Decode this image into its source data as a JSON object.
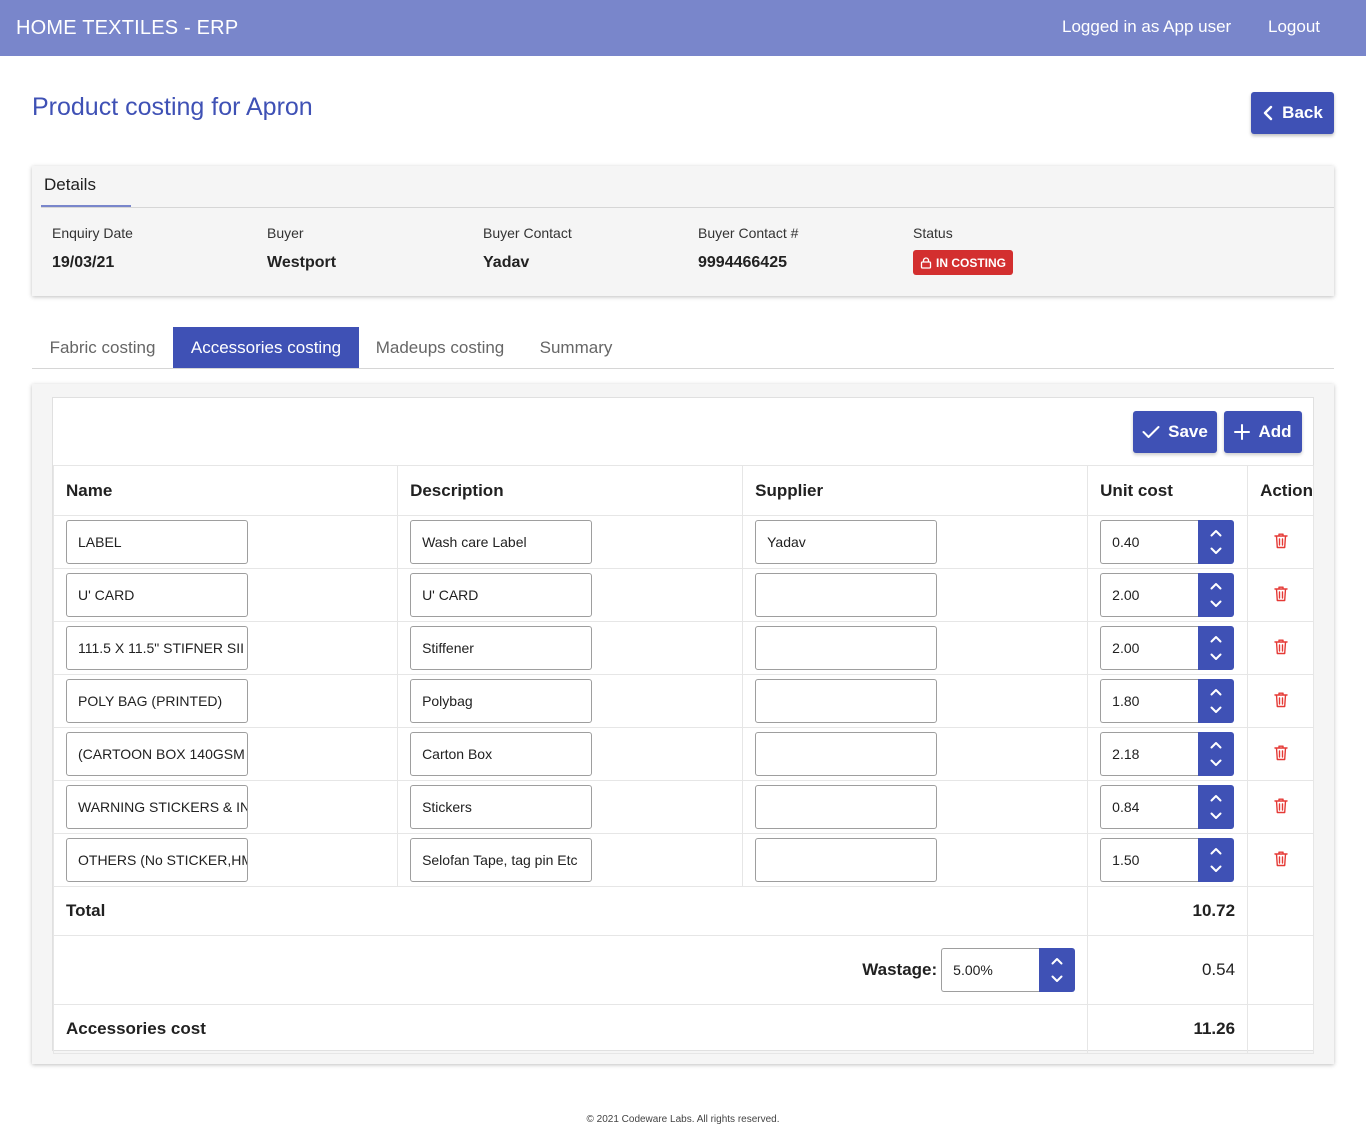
{
  "header": {
    "app_title": "HOME TEXTILES - ERP",
    "logged_in": "Logged in as App user",
    "logout": "Logout"
  },
  "page": {
    "title": "Product costing for Apron",
    "back_label": "Back"
  },
  "details": {
    "tab_label": "Details",
    "fields": [
      {
        "label": "Enquiry Date",
        "value": "19/03/21"
      },
      {
        "label": "Buyer",
        "value": "Westport"
      },
      {
        "label": "Buyer Contact",
        "value": "Yadav"
      },
      {
        "label": "Buyer Contact #",
        "value": "9994466425"
      }
    ],
    "status_label": "Status",
    "status_value": "IN COSTING",
    "status_color": "#d32f2f"
  },
  "tabs": [
    {
      "label": "Fabric costing"
    },
    {
      "label": "Accessories costing"
    },
    {
      "label": "Madeups costing"
    },
    {
      "label": "Summary"
    }
  ],
  "toolbar": {
    "save_label": "Save",
    "add_label": "Add"
  },
  "table": {
    "columns": [
      "Name",
      "Description",
      "Supplier",
      "Unit cost",
      "Action"
    ],
    "rows": [
      {
        "name": "LABEL",
        "description": "Wash care Label",
        "supplier": "Yadav",
        "unit_cost": "0.40"
      },
      {
        "name": "U' CARD",
        "description": "U' CARD",
        "supplier": "",
        "unit_cost": "2.00"
      },
      {
        "name": "111.5 X 11.5\" STIFNER SII",
        "description": "Stiffener",
        "supplier": "",
        "unit_cost": "2.00"
      },
      {
        "name": "POLY BAG (PRINTED)",
        "description": "Polybag",
        "supplier": "",
        "unit_cost": "1.80"
      },
      {
        "name": "(CARTOON BOX 140GSM",
        "description": "Carton Box",
        "supplier": "",
        "unit_cost": "2.18"
      },
      {
        "name": "WARNING STICKERS & IN",
        "description": "Stickers",
        "supplier": "",
        "unit_cost": "0.84"
      },
      {
        "name": "OTHERS (No STICKER,HM",
        "description": "Selofan Tape, tag pin Etc",
        "supplier": "",
        "unit_cost": "1.50"
      }
    ],
    "total_label": "Total",
    "total_value": "10.72",
    "wastage_label": "Wastage:",
    "wastage_input": "5.00%",
    "wastage_value": "0.54",
    "cost_label": "Accessories cost",
    "cost_value": "11.26"
  },
  "footer": {
    "text": "© 2021 Codeware Labs. All rights reserved."
  },
  "colors": {
    "primary": "#3f51b5",
    "topbar": "#7986cb",
    "danger": "#d32f2f"
  },
  "icons": {
    "back": "chevron-left-icon",
    "status": "lock-icon",
    "save": "check-icon",
    "add": "plus-icon",
    "spin_up": "chevron-up-icon",
    "spin_down": "chevron-down-icon",
    "delete": "trash-icon"
  }
}
